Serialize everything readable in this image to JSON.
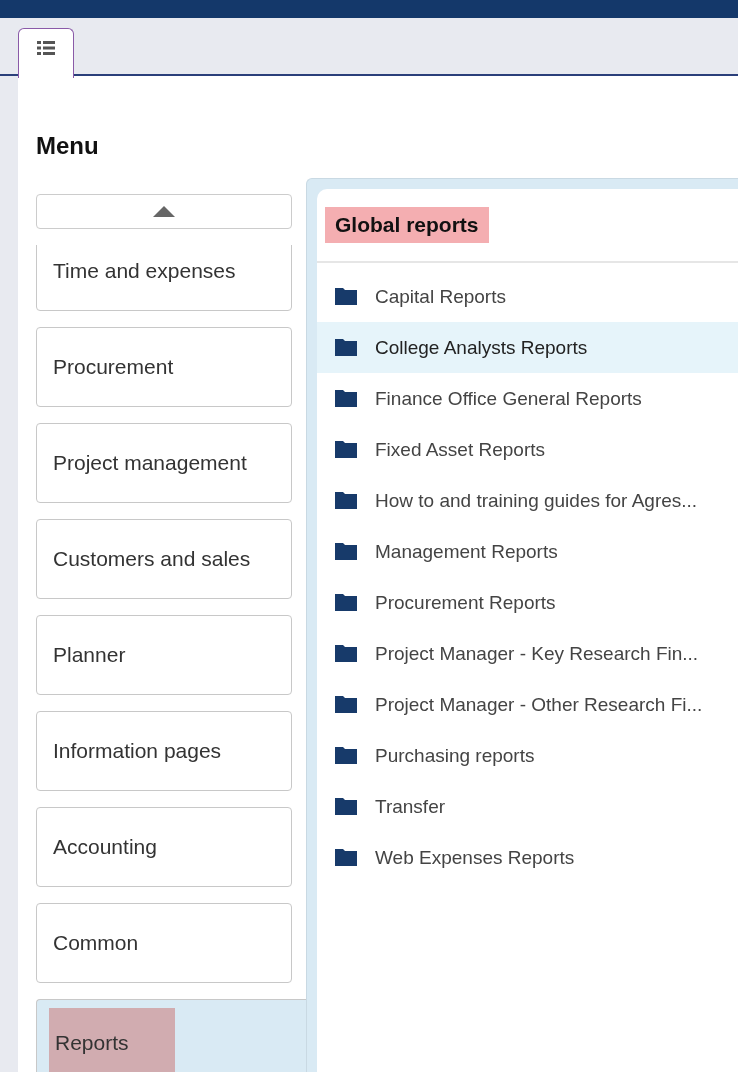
{
  "tabs": [
    {
      "selected": true
    }
  ],
  "menu": {
    "title": "Menu",
    "items": [
      {
        "label": "Time and expenses",
        "selected": false,
        "highlighted": false
      },
      {
        "label": "Procurement",
        "selected": false,
        "highlighted": false
      },
      {
        "label": "Project management",
        "selected": false,
        "highlighted": false
      },
      {
        "label": "Customers and sales",
        "selected": false,
        "highlighted": false
      },
      {
        "label": "Planner",
        "selected": false,
        "highlighted": false
      },
      {
        "label": "Information pages",
        "selected": false,
        "highlighted": false
      },
      {
        "label": "Accounting",
        "selected": false,
        "highlighted": false
      },
      {
        "label": "Common",
        "selected": false,
        "highlighted": false
      },
      {
        "label": "Reports",
        "selected": true,
        "highlighted": true
      }
    ]
  },
  "panel": {
    "title": "Global reports",
    "title_highlighted": true,
    "folders": [
      {
        "label": "Capital Reports",
        "selected": false
      },
      {
        "label": "College Analysts Reports",
        "selected": true
      },
      {
        "label": "Finance Office General Reports",
        "selected": false
      },
      {
        "label": "Fixed Asset Reports",
        "selected": false
      },
      {
        "label": "How to and training guides for Agres...",
        "selected": false
      },
      {
        "label": "Management Reports",
        "selected": false
      },
      {
        "label": "Procurement Reports",
        "selected": false
      },
      {
        "label": "Project Manager - Key Research Fin...",
        "selected": false
      },
      {
        "label": "Project Manager - Other Research Fi...",
        "selected": false
      },
      {
        "label": "Purchasing reports",
        "selected": false
      },
      {
        "label": "Transfer",
        "selected": false
      },
      {
        "label": "Web Expenses Reports",
        "selected": false
      }
    ]
  }
}
